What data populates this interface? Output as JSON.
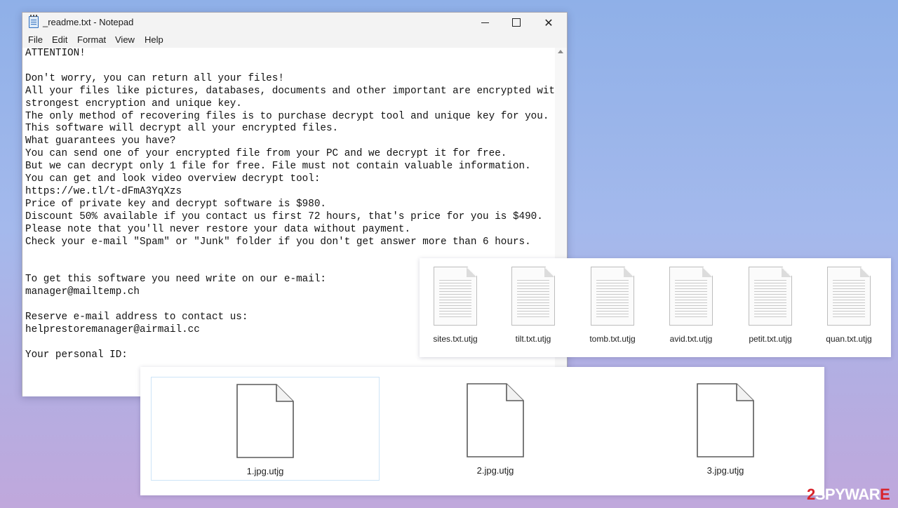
{
  "notepad": {
    "title": "_readme.txt - Notepad",
    "controls": {
      "minimize": "",
      "maximize": "",
      "close": "✕"
    },
    "menu": [
      "File",
      "Edit",
      "Format",
      "View",
      "Help"
    ],
    "content": "ATTENTION!\n\nDon't worry, you can return all your files!\nAll your files like pictures, databases, documents and other important are encrypted with\nstrongest encryption and unique key.\nThe only method of recovering files is to purchase decrypt tool and unique key for you.\nThis software will decrypt all your encrypted files.\nWhat guarantees you have?\nYou can send one of your encrypted file from your PC and we decrypt it for free.\nBut we can decrypt only 1 file for free. File must not contain valuable information.\nYou can get and look video overview decrypt tool:\nhttps://we.tl/t-dFmA3YqXzs\nPrice of private key and decrypt software is $980.\nDiscount 50% available if you contact us first 72 hours, that's price for you is $490.\nPlease note that you'll never restore your data without payment.\nCheck your e-mail \"Spam\" or \"Junk\" folder if you don't get answer more than 6 hours.\n\n\nTo get this software you need write on our e-mail:\nmanager@mailtemp.ch\n\nReserve e-mail address to contact us:\nhelprestoremanager@airmail.cc\n\nYour personal ID:"
  },
  "txt_files": [
    "sites.txt.utjg",
    "tilt.txt.utjg",
    "tomb.txt.utjg",
    "avid.txt.utjg",
    "petit.txt.utjg",
    "quan.txt.utjg"
  ],
  "jpg_files": [
    "1.jpg.utjg",
    "2.jpg.utjg",
    "3.jpg.utjg"
  ],
  "watermark": {
    "part1": "2",
    "part2": "SPYWAR",
    "part3": "E"
  },
  "colors": {
    "watermark_red": "#d8242c",
    "selection_border": "#cde4f7"
  }
}
